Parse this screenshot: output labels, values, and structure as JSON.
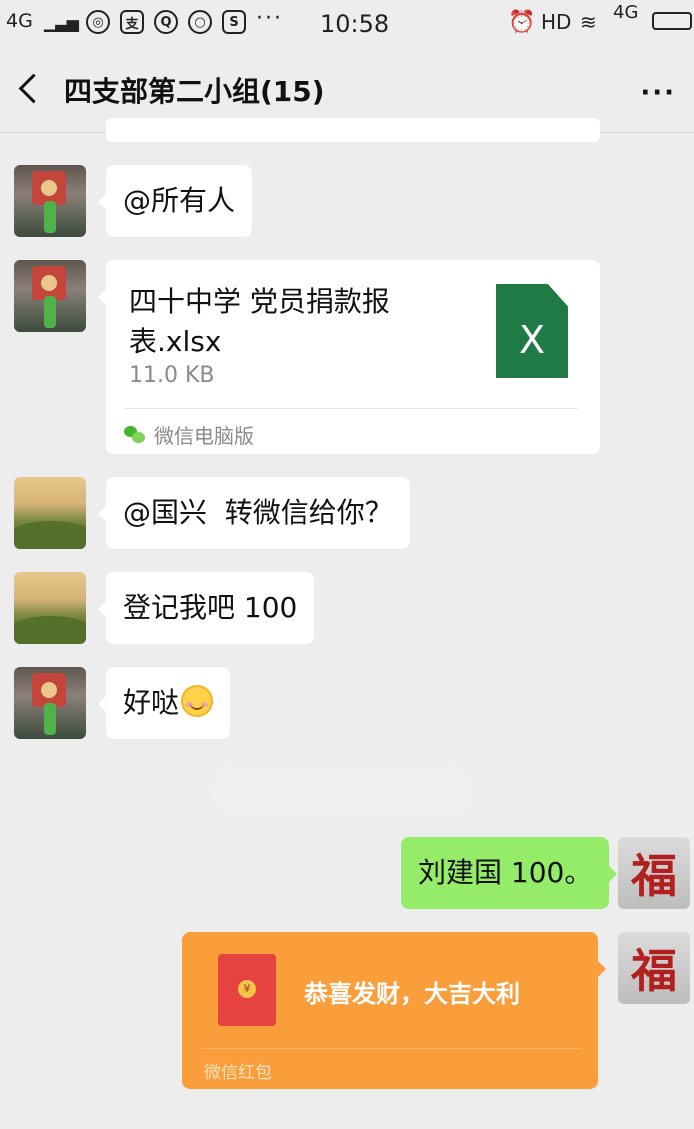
{
  "status_bar": {
    "signal_left": "4G",
    "app_icons": [
      "globe-icon",
      "pay-icon",
      "qq-icon",
      "chat-icon",
      "s-icon"
    ],
    "overflow": "···",
    "time": "10:58",
    "hd": "HD",
    "signal_right": "4G"
  },
  "chat": {
    "title": "四支部第二小组(15)",
    "more": "···"
  },
  "messages": {
    "m1": "@所有人",
    "file": {
      "name": "四十中学 党员捐款报表.xlsx",
      "size": "11.0 KB",
      "icon_letter": "X",
      "source": "微信电脑版"
    },
    "m2": "@国兴  转微信给你？",
    "m3": "登记我吧 100",
    "m4": "好哒",
    "m5": "刘建国 100。",
    "red_packet": {
      "greeting": "恭喜发财，大吉大利",
      "label": "微信红包",
      "coin": "¥"
    }
  },
  "avatars": {
    "self_text": "福"
  },
  "colors": {
    "background": "#ededed",
    "self_bubble": "#95ec69",
    "red_packet": "#fa9d3b",
    "excel": "#1f7a45"
  }
}
